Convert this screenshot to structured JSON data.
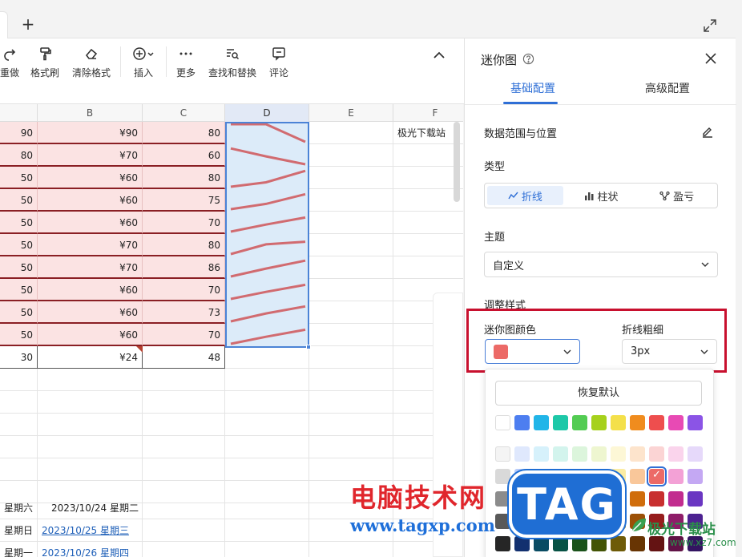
{
  "tabbar": {
    "plus": "+"
  },
  "toolbar": {
    "buttons": [
      {
        "label": "重做",
        "icon": "redo-icon"
      },
      {
        "label": "格式刷",
        "icon": "format-painter-icon"
      },
      {
        "label": "清除格式",
        "icon": "eraser-icon"
      },
      {
        "label": "插入",
        "icon": "plus-circle-icon"
      },
      {
        "label": "更多",
        "icon": "more-icon"
      },
      {
        "label": "查找和替换",
        "icon": "find-replace-icon"
      },
      {
        "label": "评论",
        "icon": "comment-icon"
      }
    ]
  },
  "grid": {
    "columns": [
      "B",
      "C",
      "D",
      "E",
      "F"
    ],
    "rows": [
      {
        "a": "90",
        "b": "¥90",
        "c": "80",
        "spark": [
          0.0,
          0.0,
          1.0
        ]
      },
      {
        "a": "80",
        "b": "¥70",
        "c": "60",
        "spark": [
          0.1,
          0.55,
          1.0
        ]
      },
      {
        "a": "50",
        "b": "¥60",
        "c": "80",
        "spark": [
          1.0,
          0.75,
          0.1
        ]
      },
      {
        "a": "50",
        "b": "¥60",
        "c": "75",
        "spark": [
          1.0,
          0.7,
          0.15
        ]
      },
      {
        "a": "50",
        "b": "¥60",
        "c": "70",
        "spark": [
          1.0,
          0.6,
          0.2
        ]
      },
      {
        "a": "50",
        "b": "¥70",
        "c": "80",
        "spark": [
          1.0,
          0.45,
          0.3
        ]
      },
      {
        "a": "50",
        "b": "¥70",
        "c": "86",
        "spark": [
          1.0,
          0.55,
          0.1
        ]
      },
      {
        "a": "50",
        "b": "¥60",
        "c": "70",
        "spark": [
          1.0,
          0.6,
          0.2
        ]
      },
      {
        "a": "50",
        "b": "¥60",
        "c": "73",
        "spark": [
          1.0,
          0.55,
          0.15
        ]
      },
      {
        "a": "50",
        "b": "¥60",
        "c": "70",
        "spark": [
          1.0,
          0.6,
          0.2
        ]
      }
    ],
    "total_row": {
      "a": "30",
      "b": "¥24",
      "c": "48"
    },
    "f1_text": "极光下载站",
    "bottom_rows": [
      {
        "a": "星期六",
        "b": "2023/10/24 星期二",
        "link": false
      },
      {
        "a": "星期日",
        "b": "2023/10/25 星期三",
        "link": true
      },
      {
        "a": "星期一",
        "b": "2023/10/26 星期四",
        "link": true
      }
    ]
  },
  "panel": {
    "title": "迷你图",
    "tabs": {
      "basic": "基础配置",
      "advanced": "高级配置"
    },
    "sections": {
      "range": "数据范围与位置",
      "type": "类型",
      "theme": "主题",
      "style": "调整样式"
    },
    "types": [
      "折线",
      "柱状",
      "盈亏"
    ],
    "theme_value": "自定义",
    "color_label": "迷你图颜色",
    "thickness_label": "折线粗细",
    "thickness_value": "3px",
    "reset_label": "恢复默认",
    "current_color": "#ec6a67"
  },
  "palette": {
    "row1": [
      "#ffffff",
      "#4d7ef0",
      "#21b5e8",
      "#1ec8a8",
      "#53cc53",
      "#a6d11c",
      "#f4e04a",
      "#f08c1e",
      "#ee4e4e",
      "#e84ab4",
      "#8b54e6"
    ],
    "row2": [
      "#f4f4f4",
      "#dfe8fd",
      "#d6f1fb",
      "#d3f4ed",
      "#dcf5dc",
      "#eef6d0",
      "#fdf7d6",
      "#fde4cc",
      "#fbd4d4",
      "#fad4ec",
      "#e6d9fa"
    ],
    "row3": [
      "#d9d9d9",
      "#b6cbfa",
      "#a9e2f6",
      "#a5e8da",
      "#b3ebb3",
      "#d8ec9e",
      "#fbeca3",
      "#f9c79a",
      "#ec6a67",
      "#f3a1d6",
      "#c4a8f3"
    ],
    "row4": [
      "#8c8c8c",
      "#2f62d6",
      "#1697c6",
      "#15a387",
      "#3aa53a",
      "#86a80f",
      "#d6b81d",
      "#d06d0b",
      "#c82f2f",
      "#c22c8f",
      "#6a36c2"
    ],
    "row5": [
      "#595959",
      "#1e4aa8",
      "#0e7196",
      "#0c7c66",
      "#277d27",
      "#657f08",
      "#a78b0d",
      "#9c5006",
      "#961d1d",
      "#8f1d69",
      "#4d2291"
    ],
    "row6": [
      "#262626",
      "#12306f",
      "#094b63",
      "#075244",
      "#1a521a",
      "#435405",
      "#6e5b08",
      "#683503",
      "#641313",
      "#601346",
      "#331561"
    ],
    "selected": "#ec6a67"
  },
  "watermark": {
    "cn": "电脑技术网",
    "url": "www.tagxp.com",
    "tag": "TAG",
    "site": "极光下载站",
    "site_url": "www.xz7.com"
  },
  "colors": {
    "accent": "#2f6fd6",
    "sparkline": "#d16b70",
    "highlight_box": "#c8102e"
  }
}
